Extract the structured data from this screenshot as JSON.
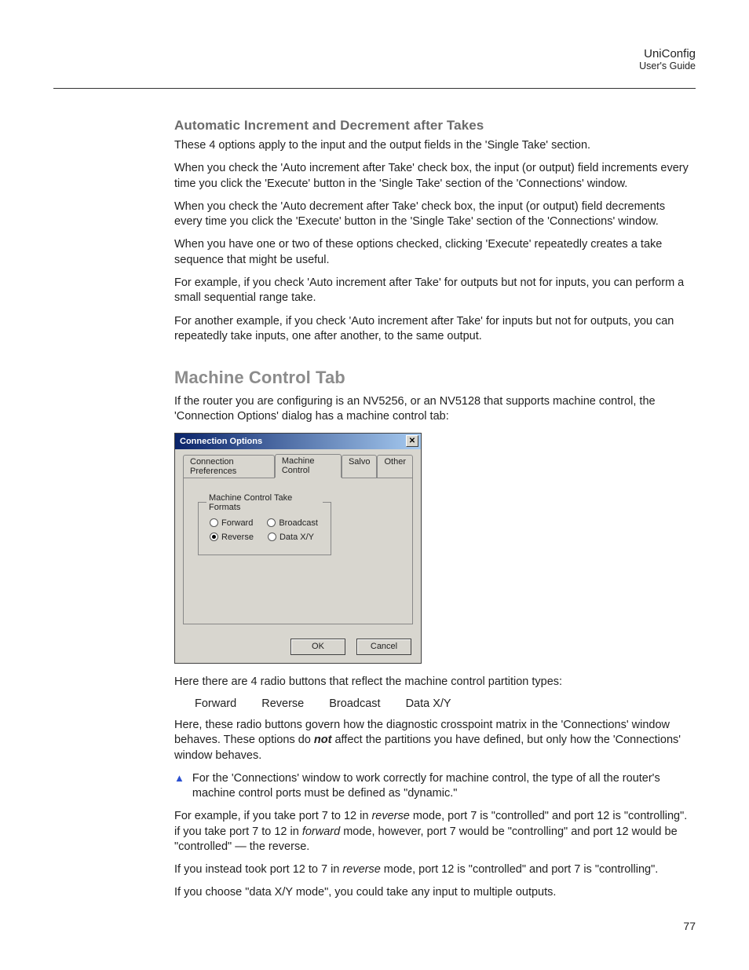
{
  "header": {
    "title": "UniConfig",
    "subtitle": "User's Guide"
  },
  "page_number": "77",
  "section1": {
    "heading": "Automatic Increment and Decrement after Takes",
    "p1": "These 4 options apply to the input and the output fields in the 'Single Take' section.",
    "p2": "When you check the 'Auto increment after Take' check box, the input (or output) field increments every time you click the 'Execute' button in the 'Single Take' section of the 'Connections' window.",
    "p3": "When you check the 'Auto decrement after Take' check box, the input (or output) field decrements every time you click the 'Execute' button in the 'Single Take' section of the 'Connections' window.",
    "p4": "When you have one or two of these options checked, clicking 'Execute' repeatedly creates a take sequence that might be useful.",
    "p5": "For example, if you check 'Auto increment after Take' for outputs but not for inputs, you can perform a small sequential range take.",
    "p6": "For another example, if you check 'Auto increment after Take' for inputs but not for outputs, you can repeatedly take inputs, one after another, to the same output."
  },
  "section2": {
    "heading": "Machine Control Tab",
    "p1": "If the router you are configuring is an NV5256, or an NV5128 that supports machine control, the 'Connection Options' dialog has a machine control tab:",
    "p2": "Here there are 4 radio buttons that reflect the machine control partition types:",
    "types": {
      "a": "Forward",
      "b": "Reverse",
      "c": "Broadcast",
      "d": "Data X/Y"
    },
    "p3a": "Here, these radio buttons govern how the diagnostic crosspoint matrix in the 'Connections' window behaves. These options do ",
    "p3b": "not",
    "p3c": " affect the partitions you have defined, but only how the 'Connections' window behaves.",
    "note": "For the 'Connections' window to work correctly for machine control, the type of all the router's machine control ports must be defined as \"dynamic.\"",
    "p4a": "For example, if you take port 7 to 12 in ",
    "p4b": "reverse",
    "p4c": " mode, port 7 is \"controlled\" and port 12 is \"controlling\". if you take port 7 to 12 in ",
    "p4d": "forward",
    "p4e": " mode, however, port 7 would be \"controlling\" and port 12 would be \"controlled\" — the reverse.",
    "p5a": "If you instead took port 12 to 7 in ",
    "p5b": "reverse",
    "p5c": " mode, port 12 is \"controlled\" and port 7 is \"controlling\".",
    "p6": "If you choose \"data X/Y mode\", you could take any input to multiple outputs."
  },
  "dialog": {
    "title": "Connection Options",
    "tabs": {
      "t1": "Connection Preferences",
      "t2": "Machine Control",
      "t3": "Salvo",
      "t4": "Other"
    },
    "fieldset_legend": "Machine Control Take Formats",
    "radios": {
      "forward": "Forward",
      "broadcast": "Broadcast",
      "reverse": "Reverse",
      "dataxy": "Data X/Y"
    },
    "selected": "reverse",
    "ok": "OK",
    "cancel": "Cancel"
  }
}
